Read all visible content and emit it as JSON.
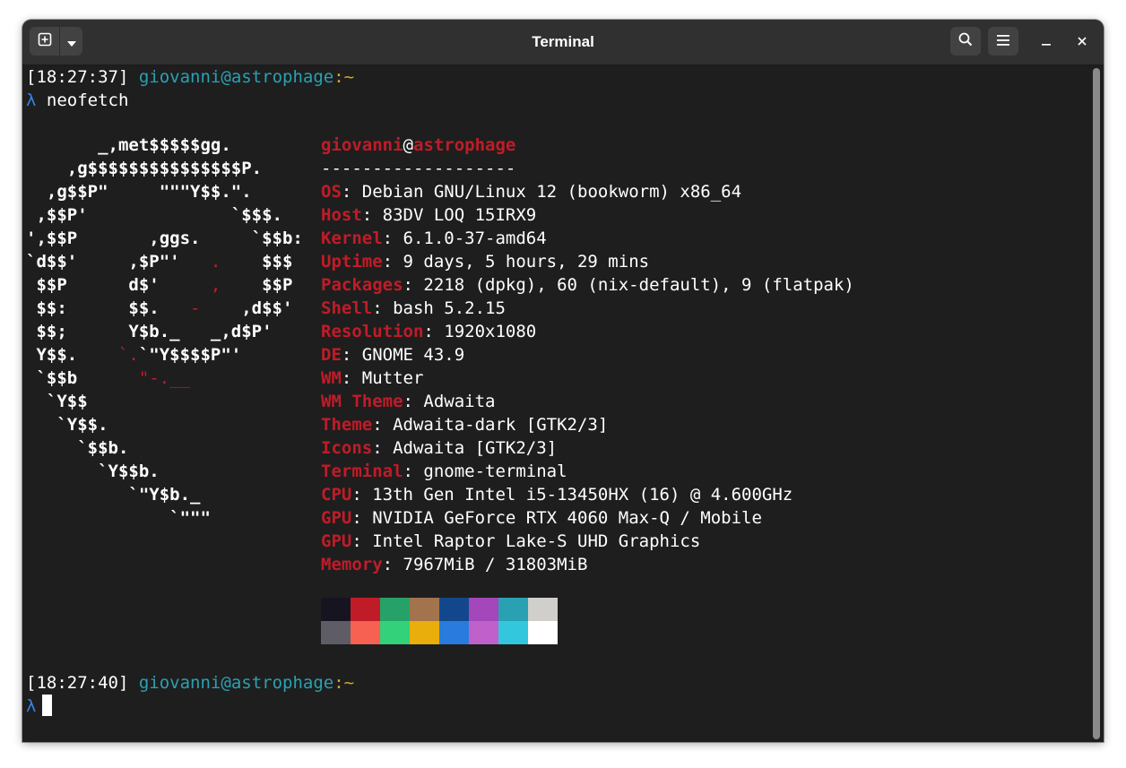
{
  "window": {
    "title": "Terminal"
  },
  "header": {
    "new_tab_icon": "new-tab-icon",
    "tab_menu_icon": "chevron-down-icon",
    "search_icon": "search-icon",
    "menu_icon": "hamburger-menu-icon",
    "minimize_label": "–",
    "close_label": "✕"
  },
  "session": {
    "prompt1": {
      "time": "[18:27:37]",
      "user": "giovanni",
      "at": "@",
      "host": "astrophage",
      "colon": ":",
      "dir": "~"
    },
    "cmd1": {
      "lambda": "λ",
      "command": "neofetch"
    },
    "prompt2": {
      "time": "[18:27:40]",
      "user": "giovanni",
      "at": "@",
      "host": "astrophage",
      "colon": ":",
      "dir": "~"
    },
    "cmd2": {
      "lambda": "λ"
    }
  },
  "logo": [
    [
      [
        "w",
        "       _,met$$$$$gg."
      ]
    ],
    [
      [
        "w",
        "    ,g$$$$$$$$$$$$$$$P."
      ]
    ],
    [
      [
        "w",
        "  ,g$$P\"     \"\"\"Y$$.\"."
      ]
    ],
    [
      [
        "w",
        " ,$$P'              `$$$."
      ]
    ],
    [
      [
        "w",
        "',$$P       ,ggs.     `$$b:"
      ]
    ],
    [
      [
        "w",
        "`d$$'     ,$P\"'   "
      ],
      [
        "r",
        "."
      ],
      [
        "w",
        "    $$$"
      ]
    ],
    [
      [
        "w",
        " $$P      d$'     "
      ],
      [
        "r",
        ","
      ],
      [
        "w",
        "    $$P"
      ]
    ],
    [
      [
        "w",
        " $$:      $$.   "
      ],
      [
        "r",
        "-"
      ],
      [
        "w",
        "    ,d$$'"
      ]
    ],
    [
      [
        "w",
        " $$;      Y$b._   _,d$P'"
      ]
    ],
    [
      [
        "w",
        " Y$$.    "
      ],
      [
        "r",
        "`."
      ],
      [
        "w",
        "`\"Y$$$$P\"'"
      ]
    ],
    [
      [
        "w",
        " `$$b      "
      ],
      [
        "r",
        "\"-.__"
      ]
    ],
    [
      [
        "w",
        "  `Y$$"
      ]
    ],
    [
      [
        "w",
        "   `Y$$."
      ]
    ],
    [
      [
        "w",
        "     `$$b."
      ]
    ],
    [
      [
        "w",
        "       `Y$$b."
      ]
    ],
    [
      [
        "w",
        "          `\"Y$b._"
      ]
    ],
    [
      [
        "w",
        "              `\"\"\""
      ]
    ]
  ],
  "info": {
    "user": "giovanni",
    "at": "@",
    "host": "astrophage",
    "separator": "-------------------",
    "rows": [
      {
        "key": "OS",
        "value": "Debian GNU/Linux 12 (bookworm) x86_64"
      },
      {
        "key": "Host",
        "value": "83DV LOQ 15IRX9"
      },
      {
        "key": "Kernel",
        "value": "6.1.0-37-amd64"
      },
      {
        "key": "Uptime",
        "value": "9 days, 5 hours, 29 mins"
      },
      {
        "key": "Packages",
        "value": "2218 (dpkg), 60 (nix-default), 9 (flatpak)"
      },
      {
        "key": "Shell",
        "value": "bash 5.2.15"
      },
      {
        "key": "Resolution",
        "value": "1920x1080"
      },
      {
        "key": "DE",
        "value": "GNOME 43.9"
      },
      {
        "key": "WM",
        "value": "Mutter"
      },
      {
        "key": "WM Theme",
        "value": "Adwaita"
      },
      {
        "key": "Theme",
        "value": "Adwaita-dark [GTK2/3]"
      },
      {
        "key": "Icons",
        "value": "Adwaita [GTK2/3]"
      },
      {
        "key": "Terminal",
        "value": "gnome-terminal"
      },
      {
        "key": "CPU",
        "value": "13th Gen Intel i5-13450HX (16) @ 4.600GHz"
      },
      {
        "key": "GPU",
        "value": "NVIDIA GeForce RTX 4060 Max-Q / Mobile"
      },
      {
        "key": "GPU",
        "value": "Intel Raptor Lake-S UHD Graphics"
      },
      {
        "key": "Memory",
        "value": "7967MiB / 31803MiB"
      }
    ],
    "separator_char": ":"
  },
  "palette": {
    "normal": [
      "#171421",
      "#c01c28",
      "#26a269",
      "#a2734c",
      "#12488b",
      "#a347ba",
      "#2aa1b3",
      "#d0cfcc"
    ],
    "bright": [
      "#5e5c64",
      "#f66151",
      "#33d17a",
      "#e9ad0c",
      "#2a7bde",
      "#c061cb",
      "#33c7de",
      "#ffffff"
    ]
  },
  "colors": {
    "background": "#1e1e1e",
    "foreground": "#ffffff",
    "accent_red": "#c01c28",
    "accent_teal": "#2aa1b3",
    "accent_yellow": "#d9a826",
    "accent_blue": "#3584e4"
  }
}
